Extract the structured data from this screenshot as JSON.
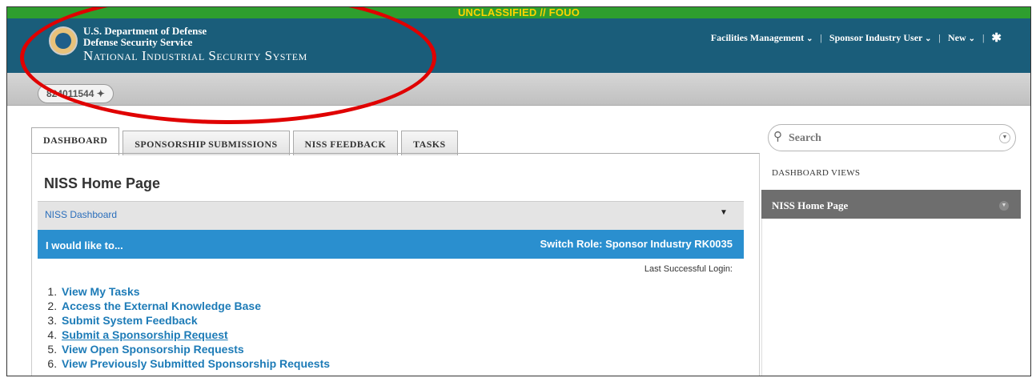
{
  "header": {
    "classification": "UNCLASSIFIED // FOUO",
    "brand_line1": "U.S. Department of Defense",
    "brand_line2": "Defense Security Service",
    "brand_line3": "National Industrial Security System",
    "nav": {
      "facilities": "Facilities Management",
      "user": "Sponsor Industry User",
      "new": "New",
      "settings_icon": "gear-icon"
    }
  },
  "subbar": {
    "pinned_record": "824011544"
  },
  "tabs": [
    {
      "label": "DASHBOARD",
      "active": true
    },
    {
      "label": "SPONSORSHIP SUBMISSIONS"
    },
    {
      "label": "NISS FEEDBACK"
    },
    {
      "label": "TASKS"
    }
  ],
  "main": {
    "title": "NISS Home Page",
    "dashboard_select": "NISS Dashboard",
    "panel_title": "I would like to...",
    "switch_role": "Switch Role: Sponsor Industry RK0035",
    "last_login": "Last Successful Login:",
    "actions": [
      "View My Tasks",
      "Access the External Knowledge Base",
      "Submit System Feedback",
      "Submit a Sponsorship Request",
      "View Open Sponsorship Requests",
      "View Previously Submitted Sponsorship Requests"
    ]
  },
  "sidebar": {
    "search_placeholder": "Search",
    "views_label": "DASHBOARD VIEWS",
    "current_view": "NISS Home Page"
  },
  "colors": {
    "topbar": "#1a5d7a",
    "classbar": "#2e9e2e",
    "classification_text": "#ffd400",
    "accent_blue": "#2a8fcf",
    "annotation_circle": "#e00000"
  }
}
